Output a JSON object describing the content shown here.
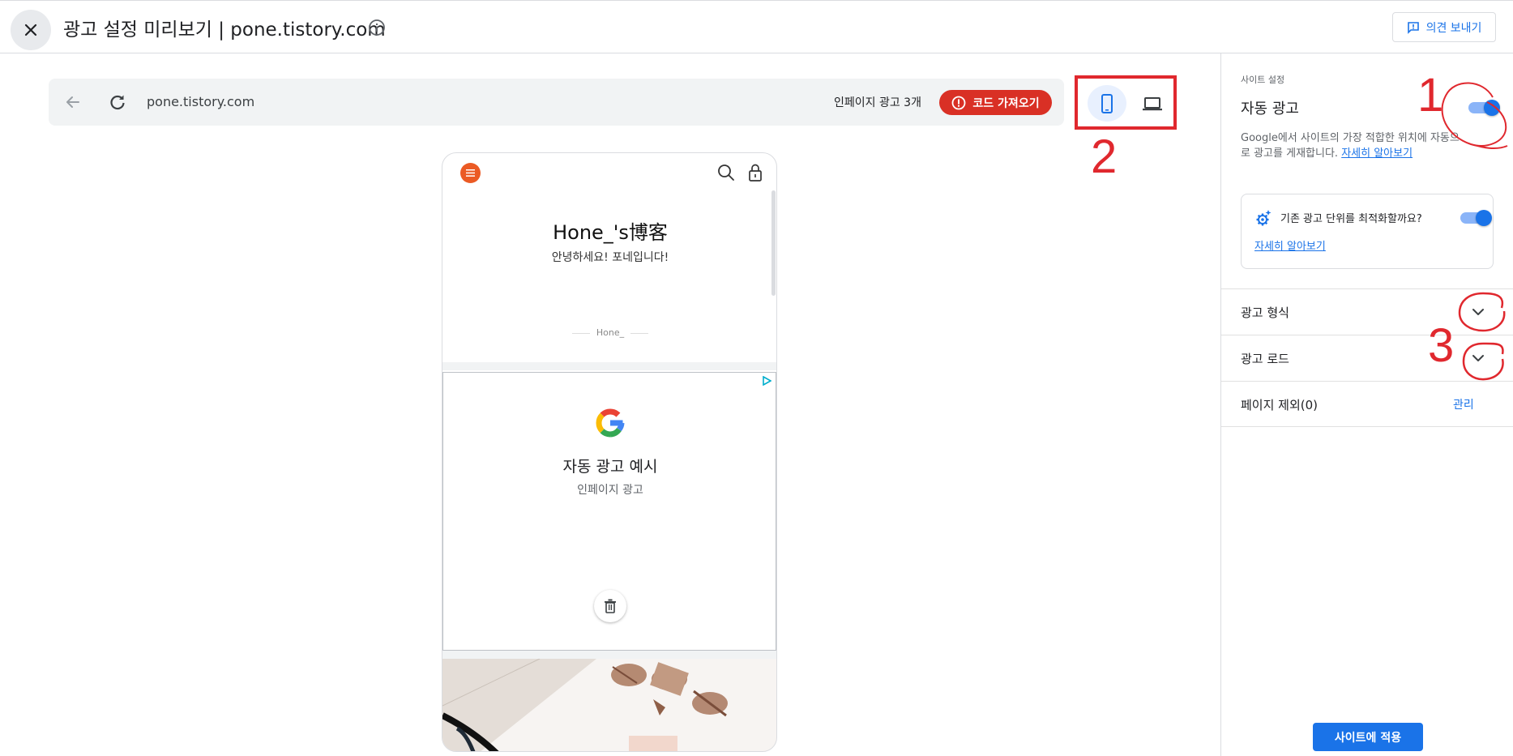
{
  "header": {
    "close_icon": "close-icon",
    "title": "광고 설정 미리보기 | pone.tistory.com",
    "info_icon": "info-icon",
    "feedback_label": "의견 보내기",
    "feedback_icon": "feedback-icon"
  },
  "preview": {
    "back_icon": "arrow-back-icon",
    "reload_icon": "reload-icon",
    "url": "pone.tistory.com",
    "inpage_count": "인페이지 광고 3개",
    "get_code_label": "코드 가져오기",
    "get_code_icon": "error-icon",
    "device_mobile_icon": "smartphone-icon",
    "device_desktop_icon": "laptop-icon"
  },
  "annotations": {
    "num1": "1",
    "num2": "2",
    "num3": "3",
    "color": "#e0282e"
  },
  "phone": {
    "menu_icon": "menu-icon",
    "search_icon": "search-icon",
    "lock_icon": "lock-icon",
    "blog_title": "Hone_'s博客",
    "greeting": "안녕하세요! 포네입니다!",
    "author": "Hone_",
    "ad": {
      "adchoices_icon": "adchoices-icon",
      "logo": "google-logo",
      "title": "자동 광고 예시",
      "subtitle": "인페이지 광고",
      "trash_icon": "trash-icon"
    }
  },
  "panel": {
    "section_label": "사이트 설정",
    "auto_ads_label": "자동 광고",
    "auto_ads_on": true,
    "description": "Google에서 사이트의 가장 적합한 위치에 자동으로 광고를 게재합니다.",
    "learn_more": "자세히 알아보기",
    "optimize_label": "기존 광고 단위를 최적화할까요?",
    "optimize_on": true,
    "optimize_learn_more": "자세히 알아보기",
    "rows": [
      {
        "label": "광고 형식"
      },
      {
        "label": "광고 로드"
      },
      {
        "label": "페이지 제외(0)",
        "action": "관리"
      }
    ],
    "apply_label": "사이트에 적용"
  },
  "colors": {
    "accent": "#1a73e8",
    "danger": "#d93025",
    "brand_orange": "#eb5a24"
  }
}
